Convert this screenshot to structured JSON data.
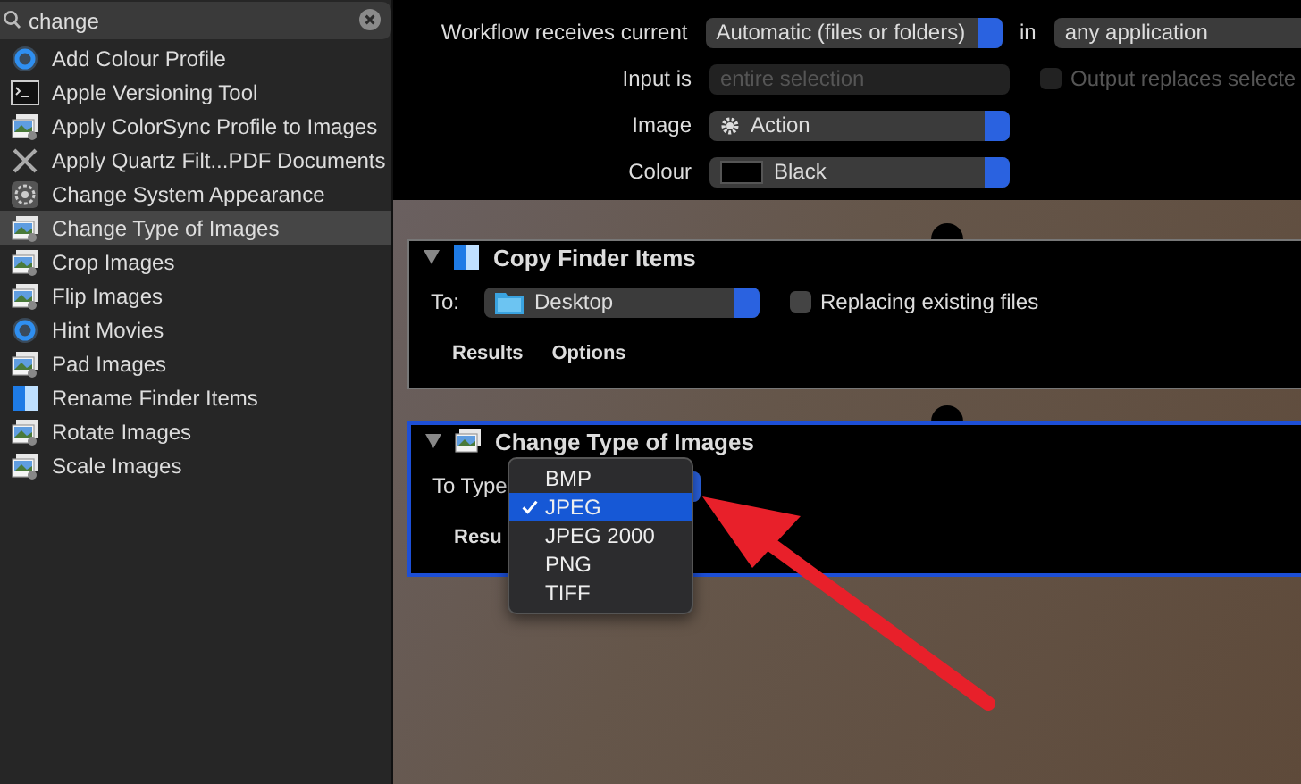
{
  "search": {
    "value": "change"
  },
  "library": {
    "items": [
      {
        "label": "Add Colour Profile",
        "kind": "disc",
        "selected": false
      },
      {
        "label": "Apple Versioning Tool",
        "kind": "terminal",
        "selected": false
      },
      {
        "label": "Apply ColorSync Profile to Images",
        "kind": "image",
        "selected": false
      },
      {
        "label": "Apply Quartz Filt...PDF Documents",
        "kind": "cross",
        "selected": false
      },
      {
        "label": "Change System Appearance",
        "kind": "gear",
        "selected": false
      },
      {
        "label": "Change Type of Images",
        "kind": "image",
        "selected": true
      },
      {
        "label": "Crop Images",
        "kind": "image",
        "selected": false
      },
      {
        "label": "Flip Images",
        "kind": "image",
        "selected": false
      },
      {
        "label": "Hint Movies",
        "kind": "disc",
        "selected": false
      },
      {
        "label": "Pad Images",
        "kind": "image",
        "selected": false
      },
      {
        "label": "Rename Finder Items",
        "kind": "square",
        "selected": false
      },
      {
        "label": "Rotate Images",
        "kind": "image",
        "selected": false
      },
      {
        "label": "Scale Images",
        "kind": "image",
        "selected": false
      }
    ]
  },
  "workflow_settings": {
    "receives": {
      "label": "Workflow receives current",
      "value": "Automatic (files or folders)"
    },
    "in_label": "in",
    "application": "any application",
    "input_is": {
      "label": "Input is",
      "value": "entire selection",
      "disabled": true
    },
    "output_replaces": {
      "label": "Output replaces selecte",
      "checked": false,
      "disabled": true
    },
    "image": {
      "label": "Image",
      "value": "Action"
    },
    "colour": {
      "label": "Colour",
      "value": "Black"
    }
  },
  "actions": [
    {
      "kind": "copy",
      "title": "Copy Finder Items",
      "selected": false,
      "to_label": "To:",
      "destination": "Desktop",
      "replace": {
        "label": "Replacing existing files",
        "checked": false
      },
      "tabs": [
        "Results",
        "Options"
      ]
    },
    {
      "kind": "convert",
      "title": "Change Type of Images",
      "selected": true,
      "to_label": "To Type",
      "tabs": [
        "Resu"
      ]
    }
  ],
  "popup_menu": {
    "options": [
      {
        "label": "BMP",
        "selected": false
      },
      {
        "label": "JPEG",
        "selected": true
      },
      {
        "label": "JPEG 2000",
        "selected": false
      },
      {
        "label": "PNG",
        "selected": false
      },
      {
        "label": "TIFF",
        "selected": false
      }
    ]
  }
}
